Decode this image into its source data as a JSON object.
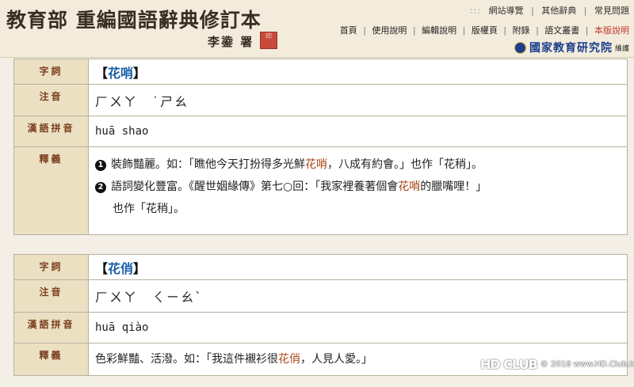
{
  "header": {
    "site_title": "教育部 重編國語辭典修訂本",
    "author_signature": "李鍌 署",
    "seal_text": "印",
    "util_nav": {
      "dots": ":::",
      "items": [
        "網站導覽",
        "其他辭典",
        "常見問題"
      ]
    },
    "main_nav": {
      "items": [
        "首頁",
        "使用說明",
        "編輯說明",
        "版權頁",
        "附錄",
        "語文叢書"
      ],
      "highlight_item": "本版說明"
    },
    "institute_name": "國家教育研究院",
    "maintain_label": "維護"
  },
  "labels": {
    "word": "字詞",
    "zhuyin": "注音",
    "pinyin": "漢語拼音",
    "definition": "釋義"
  },
  "entry1": {
    "word": "花哨",
    "zhuyin": "ㄏㄨㄚ　˙ㄕㄠ",
    "pinyin": "huā shao",
    "def1": {
      "num": "1",
      "pre": "裝飾豔麗。如：「瞧他今天打扮得多光鮮",
      "hl": "花哨",
      "post": "，八成有約會。」也作「花稍」。"
    },
    "def2": {
      "num": "2",
      "pre": "語詞變化豐富。《醒世姻緣傳》第七○回：「我家裡養著個會",
      "hl": "花哨",
      "post": "的臘嘴哩！」",
      "cont": "也作「花稍」。"
    }
  },
  "entry2": {
    "word": "花俏",
    "zhuyin": "ㄏㄨㄚ　ㄑㄧㄠˋ",
    "pinyin": "huā qiào",
    "def": {
      "pre": "色彩鮮豔、活潑。如：「我這件襯衫很",
      "hl": "花俏",
      "post": "，人見人愛。」"
    }
  },
  "watermark": {
    "logo": "HD CLUB",
    "text": "© 2018 www.HD.Club.tw"
  },
  "colors": {
    "label_bg": "#ece0c3",
    "label_text": "#7a3e1c",
    "word_blue": "#1a5fa8",
    "highlight": "#a8461a",
    "page_bg": "#f3efe6"
  }
}
